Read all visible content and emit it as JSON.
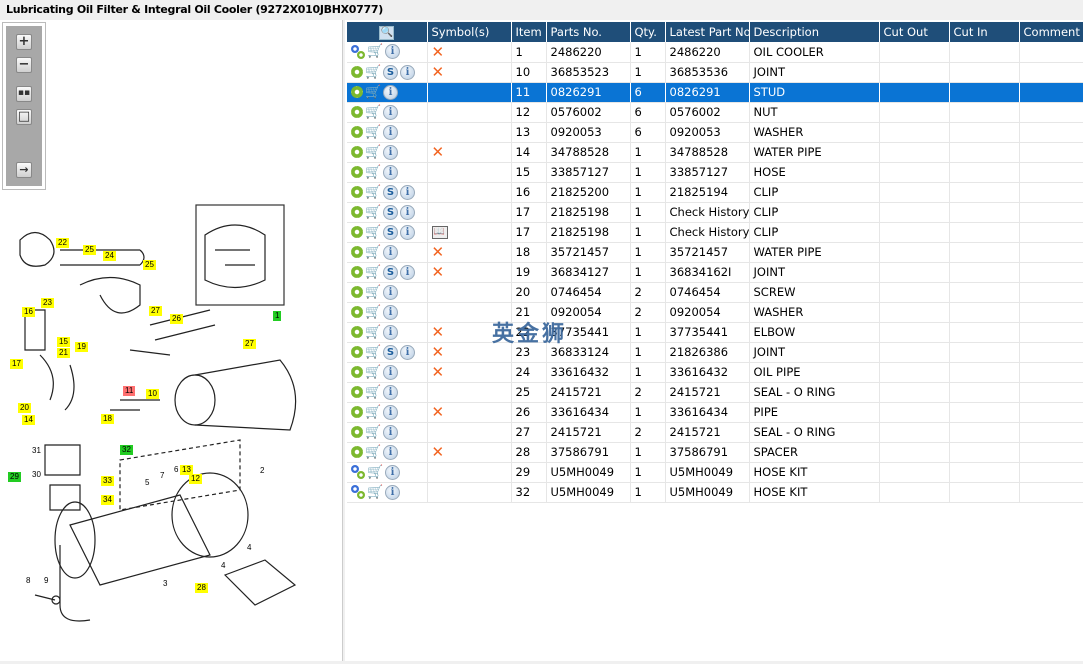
{
  "window": {
    "title": "Lubricating Oil Filter & Integral Oil Cooler (9272X010JBHX0777)"
  },
  "toolbar": {
    "buttons": [
      {
        "name": "zoom-in",
        "icon": "plus-icon"
      },
      {
        "name": "zoom-out",
        "icon": "minus-icon"
      },
      {
        "name": "fit",
        "icon": "grid-icon"
      },
      {
        "name": "actual-size",
        "icon": "square-icon"
      },
      {
        "name": "export",
        "icon": "export-arrow-icon"
      }
    ]
  },
  "diagram": {
    "callouts": [
      "22",
      "25",
      "24",
      "25",
      "23",
      "16",
      "15",
      "21",
      "19",
      "27",
      "26",
      "27",
      "17",
      "20",
      "14",
      "18",
      "11",
      "10",
      "31",
      "32",
      "29",
      "30",
      "33",
      "34",
      "5",
      "7",
      "6",
      "13",
      "12",
      "2",
      "1",
      "3",
      "4",
      "4",
      "28",
      "8",
      "9"
    ]
  },
  "table": {
    "columns": [
      "",
      "Symbol(s)",
      "Item",
      "Parts No.",
      "Qty.",
      "Latest Part No.",
      "Description",
      "Cut Out",
      "Cut In",
      "Comment"
    ],
    "header_icon": "search-catalog-icon",
    "selected_index": 2,
    "rows": [
      {
        "gear": "gears",
        "s": false,
        "sym": "x",
        "item": "1",
        "part": "2486220",
        "qty": "1",
        "latest": "2486220",
        "desc": "OIL COOLER"
      },
      {
        "gear": "gear",
        "s": true,
        "sym": "x",
        "item": "10",
        "part": "36853523",
        "qty": "1",
        "latest": "36853536",
        "desc": "JOINT"
      },
      {
        "gear": "gear",
        "s": false,
        "sym": "",
        "item": "11",
        "part": "0826291",
        "qty": "6",
        "latest": "0826291",
        "desc": "STUD"
      },
      {
        "gear": "gear",
        "s": false,
        "sym": "",
        "item": "12",
        "part": "0576002",
        "qty": "6",
        "latest": "0576002",
        "desc": "NUT"
      },
      {
        "gear": "gear",
        "s": false,
        "sym": "",
        "item": "13",
        "part": "0920053",
        "qty": "6",
        "latest": "0920053",
        "desc": "WASHER"
      },
      {
        "gear": "gear",
        "s": false,
        "sym": "x",
        "item": "14",
        "part": "34788528",
        "qty": "1",
        "latest": "34788528",
        "desc": "WATER PIPE"
      },
      {
        "gear": "gear",
        "s": false,
        "sym": "",
        "item": "15",
        "part": "33857127",
        "qty": "1",
        "latest": "33857127",
        "desc": "HOSE"
      },
      {
        "gear": "gear",
        "s": true,
        "sym": "",
        "item": "16",
        "part": "21825200",
        "qty": "1",
        "latest": "21825194",
        "desc": "CLIP"
      },
      {
        "gear": "gear",
        "s": true,
        "sym": "",
        "item": "17",
        "part": "21825198",
        "qty": "1",
        "latest": "Check History",
        "desc": "CLIP"
      },
      {
        "gear": "gear",
        "s": true,
        "sym": "book",
        "item": "17",
        "part": "21825198",
        "qty": "1",
        "latest": "Check History",
        "desc": "CLIP"
      },
      {
        "gear": "gear",
        "s": false,
        "sym": "x",
        "item": "18",
        "part": "35721457",
        "qty": "1",
        "latest": "35721457",
        "desc": "WATER PIPE"
      },
      {
        "gear": "gear",
        "s": true,
        "sym": "x",
        "item": "19",
        "part": "36834127",
        "qty": "1",
        "latest": "36834162I",
        "desc": "JOINT"
      },
      {
        "gear": "gear",
        "s": false,
        "sym": "",
        "item": "20",
        "part": "0746454",
        "qty": "2",
        "latest": "0746454",
        "desc": "SCREW"
      },
      {
        "gear": "gear",
        "s": false,
        "sym": "",
        "item": "21",
        "part": "0920054",
        "qty": "2",
        "latest": "0920054",
        "desc": "WASHER"
      },
      {
        "gear": "gear",
        "s": false,
        "sym": "x",
        "item": "22",
        "part": "37735441",
        "qty": "1",
        "latest": "37735441",
        "desc": "ELBOW"
      },
      {
        "gear": "gear",
        "s": true,
        "sym": "x",
        "item": "23",
        "part": "36833124",
        "qty": "1",
        "latest": "21826386",
        "desc": "JOINT"
      },
      {
        "gear": "gear",
        "s": false,
        "sym": "x",
        "item": "24",
        "part": "33616432",
        "qty": "1",
        "latest": "33616432",
        "desc": "OIL PIPE"
      },
      {
        "gear": "gear",
        "s": false,
        "sym": "",
        "item": "25",
        "part": "2415721",
        "qty": "2",
        "latest": "2415721",
        "desc": "SEAL - O RING"
      },
      {
        "gear": "gear",
        "s": false,
        "sym": "x",
        "item": "26",
        "part": "33616434",
        "qty": "1",
        "latest": "33616434",
        "desc": "PIPE"
      },
      {
        "gear": "gear",
        "s": false,
        "sym": "",
        "item": "27",
        "part": "2415721",
        "qty": "2",
        "latest": "2415721",
        "desc": "SEAL - O RING"
      },
      {
        "gear": "gear",
        "s": false,
        "sym": "x",
        "item": "28",
        "part": "37586791",
        "qty": "1",
        "latest": "37586791",
        "desc": "SPACER"
      },
      {
        "gear": "gears",
        "s": false,
        "sym": "",
        "item": "29",
        "part": "U5MH0049",
        "qty": "1",
        "latest": "U5MH0049",
        "desc": "HOSE KIT"
      },
      {
        "gear": "gears",
        "s": false,
        "sym": "",
        "item": "32",
        "part": "U5MH0049",
        "qty": "1",
        "latest": "U5MH0049",
        "desc": "HOSE KIT"
      }
    ]
  },
  "watermark": "英金狮",
  "colors": {
    "header": "#1f4e79",
    "selected": "#0a74d4",
    "symbol_x": "#f26522",
    "callout_yellow": "#ffff00",
    "callout_green": "#22cc22",
    "callout_red": "#ff7070"
  }
}
